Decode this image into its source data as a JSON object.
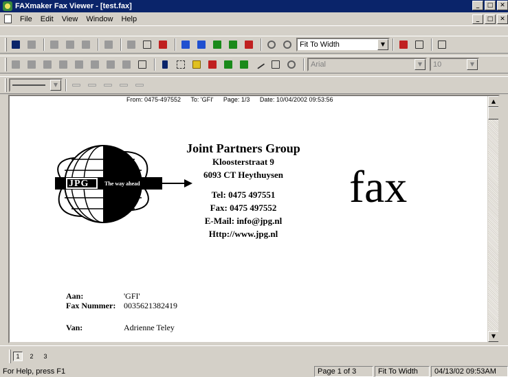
{
  "window": {
    "title": "FAXmaker Fax Viewer - [test.fax]",
    "minimize": "_",
    "maximize": "□",
    "close": "✕"
  },
  "menu": {
    "items": [
      "File",
      "Edit",
      "View",
      "Window",
      "Help"
    ]
  },
  "toolbar": {
    "zoom_value": "Fit To Width",
    "font_value": "Arial",
    "font_size_value": "10"
  },
  "fax": {
    "header": {
      "from": "From: 0475-497552",
      "to": "To: 'GFI'",
      "page": "Page: 1/3",
      "date": "Date: 10/04/2002 09:53:56"
    },
    "logo_text": "JPG",
    "logo_tagline": "The way ahead",
    "company": {
      "name": "Joint Partners Group",
      "street": "Kloosterstraat 9",
      "city": "6093 CT Heythuysen",
      "tel": "Tel: 0475 497551",
      "fax": "Fax: 0475 497552",
      "email": "E-Mail: info@jpg.nl",
      "web": "Http://www.jpg.nl"
    },
    "fax_word": "fax",
    "fields": {
      "aan_label": "Aan:",
      "aan_value": "'GFI'",
      "faxnr_label": "Fax Nummer:",
      "faxnr_value": "0035621382419",
      "van_label": "Van:",
      "van_value": "Adrienne Teley"
    }
  },
  "pages": [
    "1",
    "2",
    "3"
  ],
  "status": {
    "help": "For Help, press F1",
    "page": "Page 1 of 3",
    "zoom": "Fit To Width",
    "datetime": "04/13/02 09:53AM"
  }
}
